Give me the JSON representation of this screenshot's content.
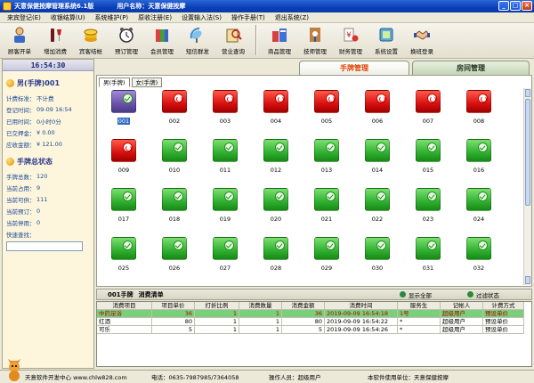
{
  "titlebar": {
    "title": "天意保健按摩管理系统6.1版",
    "user_label": "用户名称：天意保健按摩",
    "minimize": "_",
    "maximize": "□",
    "close": "×"
  },
  "menu": [
    "来宾登记(E)",
    "收银结算(U)",
    "系统维护(P)",
    "原收注册(E)",
    "设置输入法(S)",
    "操作手册(T)",
    "退出系统(Z)"
  ],
  "toolbar": [
    {
      "label": "顾客开单",
      "icon": "customer-icon"
    },
    {
      "label": "增加消费",
      "icon": "wine-icon"
    },
    {
      "label": "宾客结帐",
      "icon": "coins-icon"
    },
    {
      "label": "预订管理",
      "icon": "clock-icon"
    },
    {
      "label": "会员管理",
      "icon": "members-icon"
    },
    {
      "label": "短信群发",
      "icon": "satellite-icon"
    },
    {
      "label": "营业查询",
      "icon": "search-book-icon"
    },
    {
      "label": "商品管理",
      "icon": "goods-icon"
    },
    {
      "label": "技师管理",
      "icon": "therapist-icon"
    },
    {
      "label": "财务管理",
      "icon": "finance-icon"
    },
    {
      "label": "系统设置",
      "icon": "settings-icon"
    },
    {
      "label": "换班登录",
      "icon": "handshake-icon"
    }
  ],
  "clock": "16:54:30",
  "current_room": {
    "title": "男(手牌)001",
    "rows": [
      {
        "k": "计费标准：",
        "v": "不计费"
      },
      {
        "k": "登记时间：",
        "v": "09-09 16:54"
      },
      {
        "k": "已用时间：",
        "v": "0小时0分"
      },
      {
        "k": "已交押金：",
        "v": "¥ 0.00"
      },
      {
        "k": "应收金额：",
        "v": "¥ 121.00"
      }
    ]
  },
  "summary": {
    "title": "手牌总状态",
    "rows": [
      {
        "k": "手牌总数：",
        "v": "120"
      },
      {
        "k": "当前占用：",
        "v": "9"
      },
      {
        "k": "当前可供：",
        "v": "111"
      },
      {
        "k": "当前预订：",
        "v": "0"
      },
      {
        "k": "当前停用：",
        "v": "0"
      }
    ],
    "search_label": "快速查找："
  },
  "tabs": {
    "active": "手牌管理",
    "inactive": "房间管理"
  },
  "subtabs": {
    "active": "男(手牌)",
    "inactive": "女(手牌)"
  },
  "rooms": [
    {
      "n": "001",
      "s": "purple",
      "sel": true
    },
    {
      "n": "002",
      "s": "red"
    },
    {
      "n": "003",
      "s": "red"
    },
    {
      "n": "004",
      "s": "red"
    },
    {
      "n": "005",
      "s": "red"
    },
    {
      "n": "006",
      "s": "red"
    },
    {
      "n": "007",
      "s": "red"
    },
    {
      "n": "008",
      "s": "red"
    },
    {
      "n": "009",
      "s": "red"
    },
    {
      "n": "010",
      "s": "green"
    },
    {
      "n": "011",
      "s": "green"
    },
    {
      "n": "012",
      "s": "green"
    },
    {
      "n": "013",
      "s": "green"
    },
    {
      "n": "014",
      "s": "green"
    },
    {
      "n": "015",
      "s": "green"
    },
    {
      "n": "016",
      "s": "green"
    },
    {
      "n": "017",
      "s": "green"
    },
    {
      "n": "018",
      "s": "green"
    },
    {
      "n": "019",
      "s": "green"
    },
    {
      "n": "020",
      "s": "green"
    },
    {
      "n": "021",
      "s": "green"
    },
    {
      "n": "022",
      "s": "green"
    },
    {
      "n": "023",
      "s": "green"
    },
    {
      "n": "024",
      "s": "green"
    },
    {
      "n": "025",
      "s": "green"
    },
    {
      "n": "026",
      "s": "green"
    },
    {
      "n": "027",
      "s": "green"
    },
    {
      "n": "028",
      "s": "green"
    },
    {
      "n": "029",
      "s": "green"
    },
    {
      "n": "030",
      "s": "green"
    },
    {
      "n": "031",
      "s": "green"
    },
    {
      "n": "032",
      "s": "green"
    }
  ],
  "bill": {
    "room": "001手牌",
    "title": "消费清单",
    "show_all": "显示全部",
    "filter": "过滤状态",
    "headers": [
      "消费项目",
      "项目单价",
      "打折比例",
      "消费数量",
      "消费金额",
      "消费时间",
      "服务生",
      "记帐人",
      "计费方式"
    ],
    "rows": [
      [
        "中药足浴",
        "36",
        "1",
        "1",
        "36",
        "2019-09-09 16:54:18",
        "1号",
        "超级用户",
        "预设单价"
      ],
      [
        "红酒",
        "80",
        "1",
        "1",
        "80",
        "2019-09-09 16:54:22",
        "*",
        "超级用户",
        "预设单价"
      ],
      [
        "可乐",
        "5",
        "1",
        "1",
        "5",
        "2019-09-09 16:54:26",
        "*",
        "超级用户",
        "预设单价"
      ]
    ]
  },
  "status": {
    "company": "天意软件开发中心 www.chlw828.com",
    "phone": "电话：0635-7987985/7364058",
    "operator": "操作人员：超级用户",
    "unit": "本软件使用单位：天意保健按摩"
  }
}
